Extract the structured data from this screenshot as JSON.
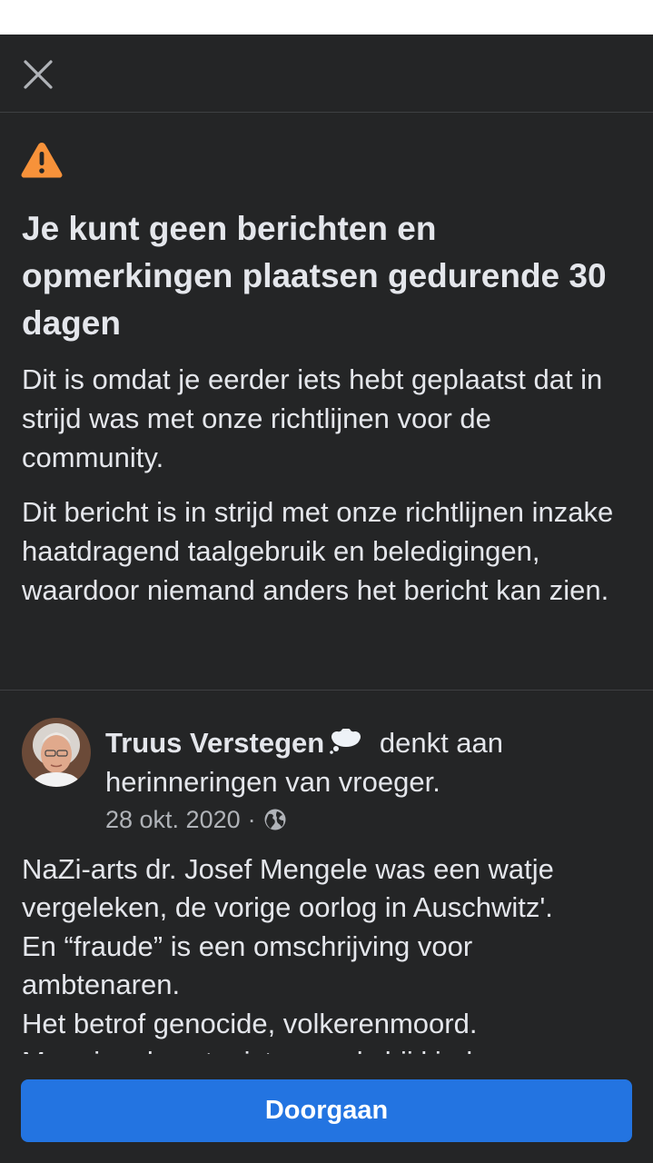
{
  "colors": {
    "background": "#242526",
    "text": "#e4e6eb",
    "secondary_text": "#b0b3b8",
    "divider": "#3e4042",
    "warning": "#f7923a",
    "primary_button": "#2374e1"
  },
  "header": {
    "close_icon": "close-icon"
  },
  "notice": {
    "icon": "warning-icon",
    "title": "Je kunt geen berichten en opmerkingen plaatsen gedurende 30 dagen",
    "paragraph1": "Dit is omdat je eerder iets hebt geplaatst dat in strijd was met onze richtlijnen voor de community.",
    "paragraph2": "Dit bericht is in strijd met onze richtlijnen inzake haatdragend taalgebruik en beledigingen, waardoor niemand anders het bericht kan zien."
  },
  "post": {
    "author": "Truus Verstegen",
    "activity_icon": "thought-bubble-icon",
    "activity": "denkt aan herinneringen van vroeger.",
    "date": "28 okt. 2020",
    "separator": "·",
    "audience_icon": "globe-icon",
    "lines": [
      "NaZi-arts dr. Josef Mengele was een watje",
      "vergeleken, de vorige oorlog in Auschwitz'.",
      "En “fraude” is een omschrijving voor",
      "ambtenaren.",
      "Het betrof genocide, volkerenmoord.",
      "Maar ja, als satanisten zoals bij kinderen"
    ]
  },
  "footer": {
    "continue_label": "Doorgaan"
  }
}
